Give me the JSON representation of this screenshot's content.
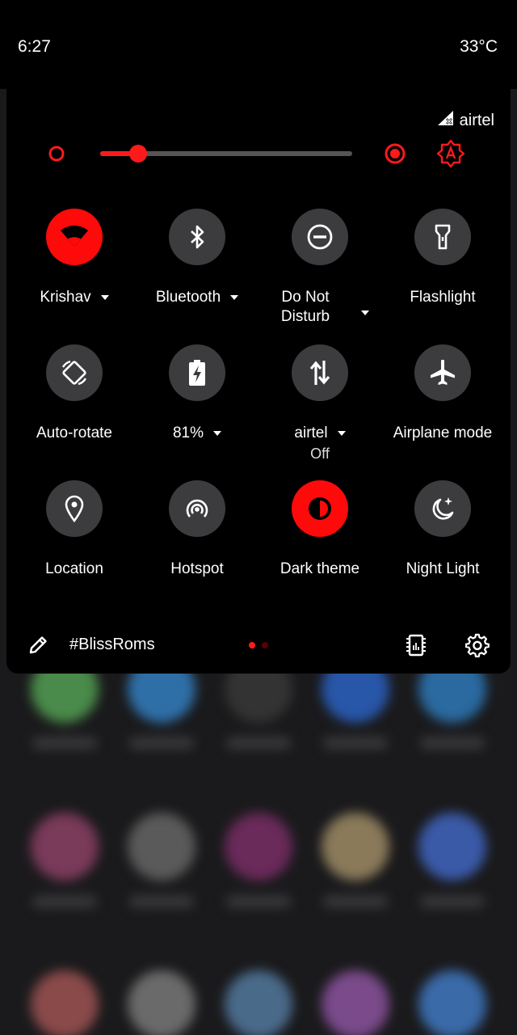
{
  "status_bar": {
    "time": "6:27",
    "temperature": "33°C"
  },
  "carrier": {
    "name": "airtel",
    "icon": "no-signal-icon"
  },
  "brightness": {
    "level": 0.15,
    "auto_icon": "auto-brightness-icon"
  },
  "tiles": [
    {
      "label": "Krishav",
      "icon": "wifi-icon",
      "active": true,
      "dropdown": true
    },
    {
      "label": "Bluetooth",
      "icon": "bluetooth-icon",
      "active": false,
      "dropdown": true
    },
    {
      "label": "Do Not Disturb",
      "icon": "dnd-icon",
      "active": false,
      "dropdown": true
    },
    {
      "label": "Flashlight",
      "icon": "flashlight-icon",
      "active": false,
      "dropdown": false
    },
    {
      "label": "Auto-rotate",
      "icon": "rotate-icon",
      "active": false,
      "dropdown": false
    },
    {
      "label": "81%",
      "icon": "battery-saver-icon",
      "active": false,
      "dropdown": true
    },
    {
      "label": "airtel",
      "sublabel": "Off",
      "icon": "mobile-data-icon",
      "active": false,
      "dropdown": true
    },
    {
      "label": "Airplane mode",
      "icon": "airplane-icon",
      "active": false,
      "dropdown": false
    },
    {
      "label": "Location",
      "icon": "location-icon",
      "active": false,
      "dropdown": false
    },
    {
      "label": "Hotspot",
      "icon": "hotspot-icon",
      "active": false,
      "dropdown": false
    },
    {
      "label": "Dark theme",
      "icon": "dark-theme-icon",
      "active": true,
      "dropdown": false
    },
    {
      "label": "Night Light",
      "icon": "night-light-icon",
      "active": false,
      "dropdown": false
    }
  ],
  "footer": {
    "build_text": "#BlissRoms",
    "page_count": 2,
    "current_page": 1
  },
  "colors": {
    "accent": "#ff0a0a",
    "tile_off": "#3c3c3e",
    "panel": "#000000"
  }
}
